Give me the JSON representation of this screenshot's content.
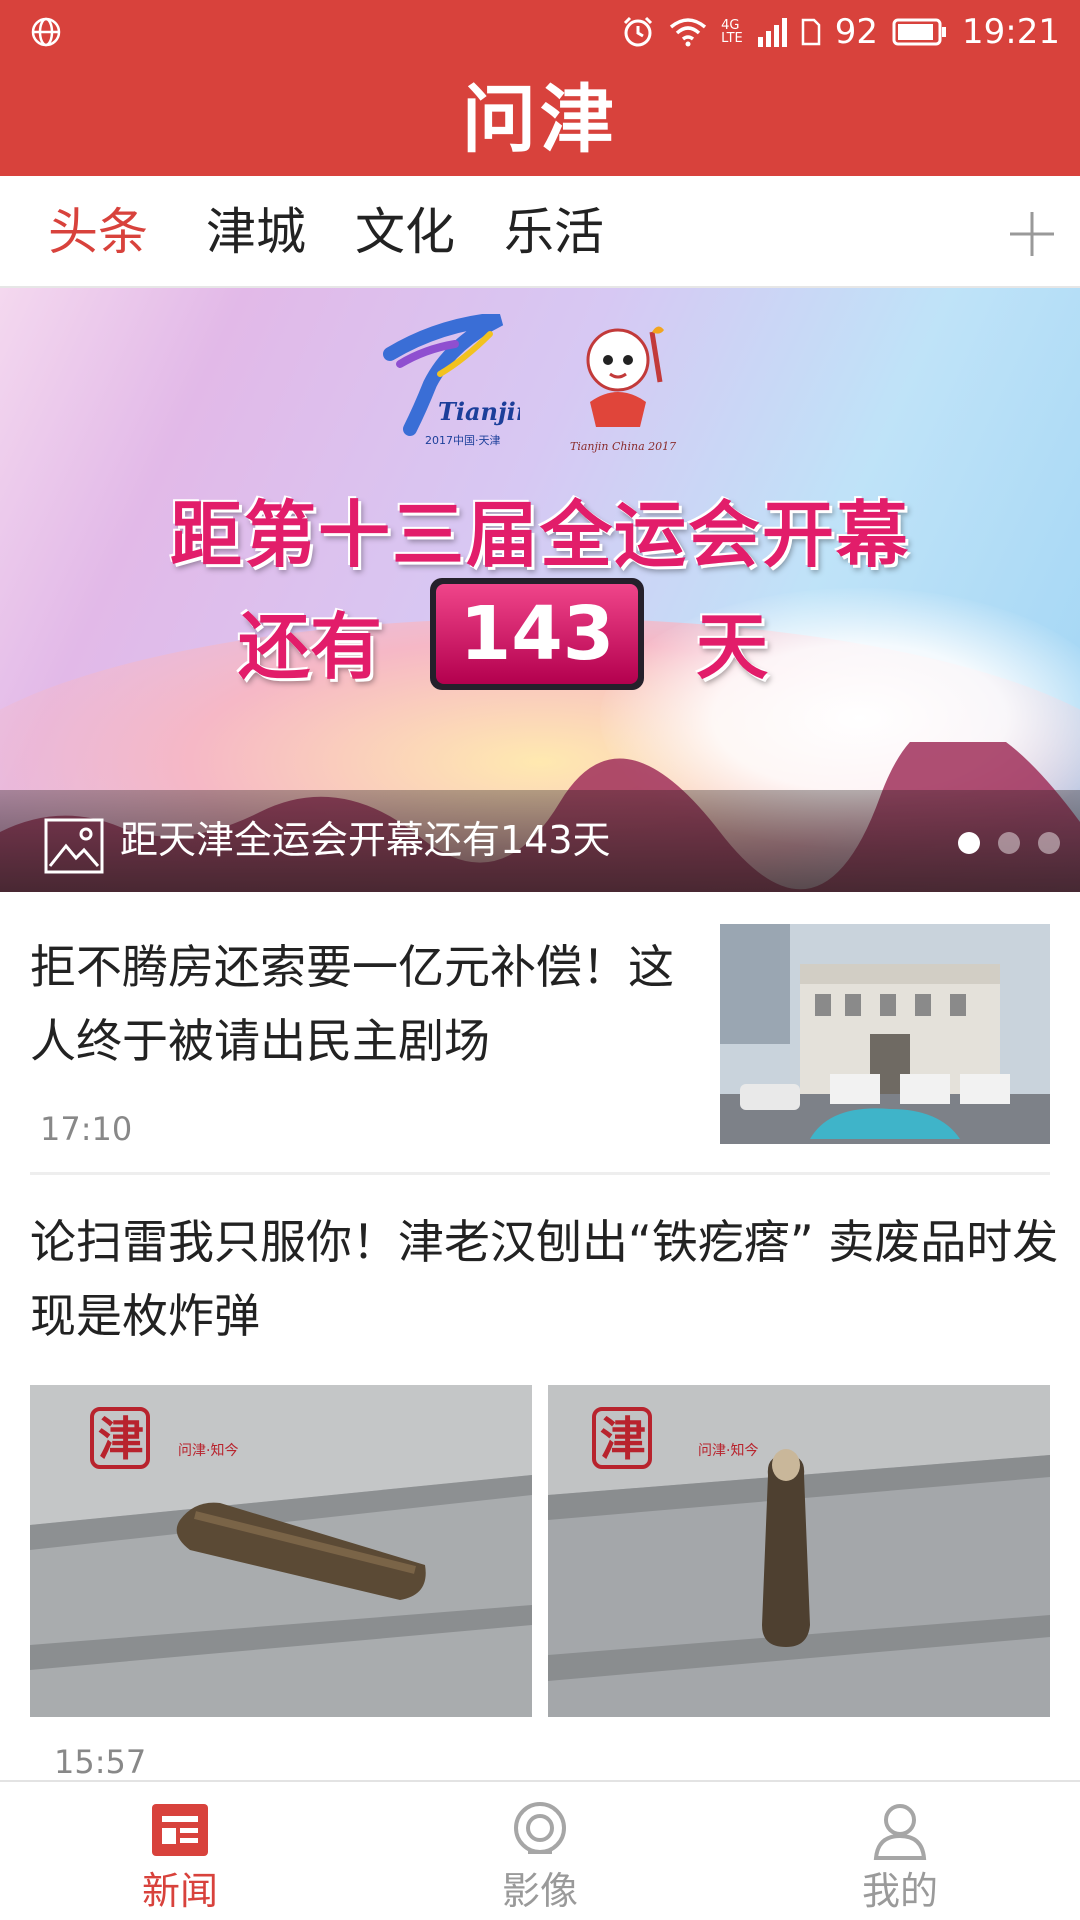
{
  "status_bar": {
    "network": "4G",
    "network_sub": "LTE",
    "battery_level": "92",
    "battery_fraction": 0.92,
    "time": "19:21"
  },
  "header": {
    "app_title": "问津",
    "brand_color": "#d8423c"
  },
  "tabs": [
    {
      "label": "头条",
      "active": true
    },
    {
      "label": "津城",
      "active": false
    },
    {
      "label": "文化",
      "active": false
    },
    {
      "label": "乐活",
      "active": false
    }
  ],
  "banner": {
    "headline": "距第十三届全运会开幕",
    "line2_prefix": "还有",
    "countdown": "143",
    "line2_suffix": "天",
    "emblem_text": "Tianjin",
    "emblem_subtext": "2017中国·天津",
    "mascot_text": "Tianjin China 2017",
    "caption": "距天津全运会开幕还有143天",
    "slides_total": 3,
    "slide_active": 1
  },
  "articles": [
    {
      "title": "拒不腾房还索要一亿元补偿！这人终于被请出民主剧场",
      "time": "17:10",
      "layout": "single-thumbnail"
    },
    {
      "title": "论扫雷我只服你！津老汉刨出“铁疙瘩” 卖废品时发现是枚炸弹",
      "time": "15:57",
      "layout": "two-images",
      "watermark": "问津·知今"
    }
  ],
  "bottom_nav": [
    {
      "label": "新闻",
      "icon": "news-icon",
      "active": true
    },
    {
      "label": "影像",
      "icon": "camera-icon",
      "active": false
    },
    {
      "label": "我的",
      "icon": "profile-icon",
      "active": false
    }
  ]
}
